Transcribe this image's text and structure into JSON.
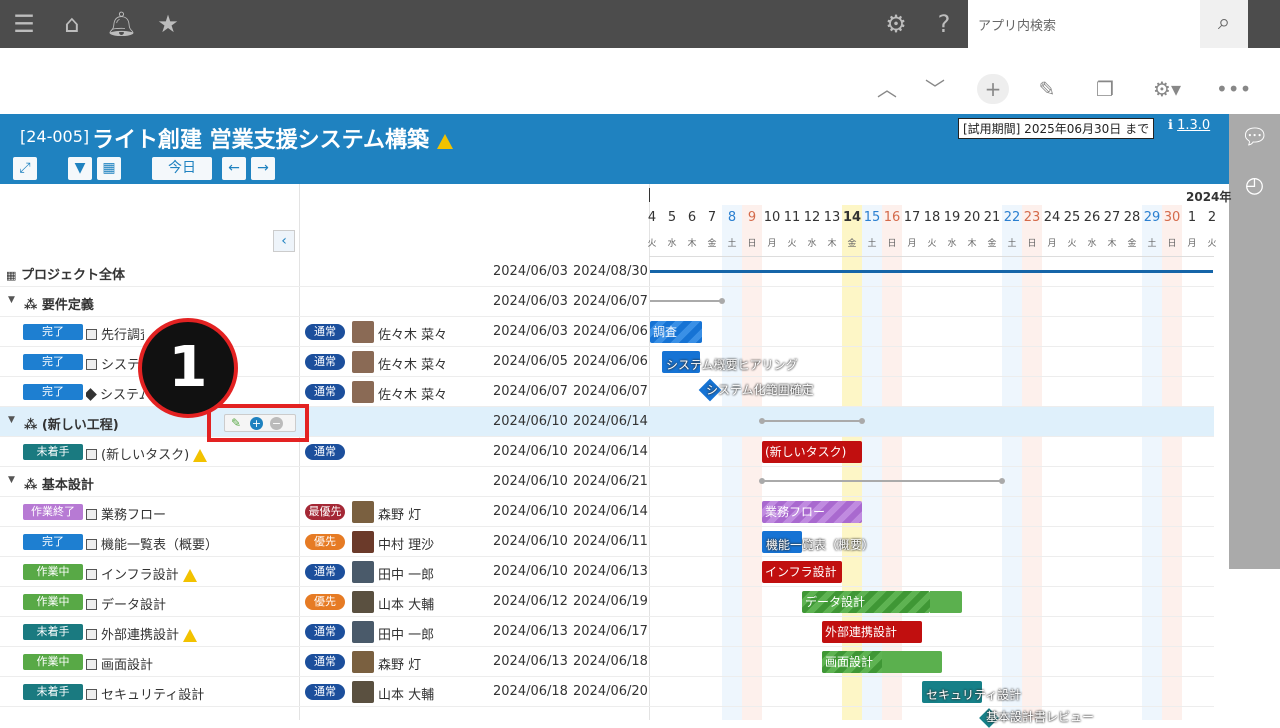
{
  "topbar": {
    "search_placeholder": "アプリ内検索"
  },
  "project": {
    "id": "[24-005]",
    "title": "ライト創建 営業支援システム構築",
    "trial": "[試用期間] 2025年06月30日 まで",
    "version": "1.3.0"
  },
  "header_buttons": {
    "today": "今日"
  },
  "calendar": {
    "year_label": "2024年",
    "days": [
      "4",
      "5",
      "6",
      "7",
      "8",
      "9",
      "10",
      "11",
      "12",
      "13",
      "14",
      "15",
      "16",
      "17",
      "18",
      "19",
      "20",
      "21",
      "22",
      "23",
      "24",
      "25",
      "26",
      "27",
      "28",
      "29",
      "30",
      "1",
      "2"
    ],
    "weekdays": [
      "火",
      "水",
      "木",
      "金",
      "土",
      "日",
      "月",
      "火",
      "水",
      "木",
      "金",
      "土",
      "日",
      "月",
      "火",
      "水",
      "木",
      "金",
      "土",
      "日",
      "月",
      "火",
      "水",
      "木",
      "金",
      "土",
      "日",
      "月",
      "火"
    ]
  },
  "rows": [
    {
      "type": "project",
      "name": "プロジェクト全体",
      "start": "2024/06/03",
      "end": "2024/08/30"
    },
    {
      "type": "phase",
      "name": "要件定義",
      "start": "2024/06/03",
      "end": "2024/06/07"
    },
    {
      "type": "task",
      "status": "完了",
      "name": "先行調査",
      "priority": "通常",
      "person": "佐々木 菜々",
      "start": "2024/06/03",
      "end": "2024/06/06"
    },
    {
      "type": "task",
      "status": "完了",
      "name": "システム概要ヒアリング",
      "priority": "通常",
      "person": "佐々木 菜々",
      "start": "2024/06/05",
      "end": "2024/06/06"
    },
    {
      "type": "milestone",
      "status": "完了",
      "name": "システム化範囲確定",
      "priority": "通常",
      "person": "佐々木 菜々",
      "start": "2024/06/07",
      "end": "2024/06/07"
    },
    {
      "type": "phase",
      "name": "(新しい工程)",
      "start": "2024/06/10",
      "end": "2024/06/14"
    },
    {
      "type": "task",
      "status": "未着手",
      "name": "(新しいタスク)",
      "priority": "通常",
      "person": "",
      "start": "2024/06/10",
      "end": "2024/06/14"
    },
    {
      "type": "phase",
      "name": "基本設計",
      "start": "2024/06/10",
      "end": "2024/06/21"
    },
    {
      "type": "task",
      "status": "作業終了",
      "name": "業務フロー",
      "priority": "最優先",
      "person": "森野 灯",
      "start": "2024/06/10",
      "end": "2024/06/14"
    },
    {
      "type": "task",
      "status": "完了",
      "name": "機能一覧表（概要）",
      "priority": "優先",
      "person": "中村 理沙",
      "start": "2024/06/10",
      "end": "2024/06/11"
    },
    {
      "type": "task",
      "status": "作業中",
      "name": "インフラ設計",
      "priority": "通常",
      "person": "田中 一郎",
      "start": "2024/06/10",
      "end": "2024/06/13"
    },
    {
      "type": "task",
      "status": "作業中",
      "name": "データ設計",
      "priority": "優先",
      "person": "山本 大輔",
      "start": "2024/06/12",
      "end": "2024/06/19"
    },
    {
      "type": "task",
      "status": "未着手",
      "name": "外部連携設計",
      "priority": "通常",
      "person": "田中 一郎",
      "start": "2024/06/13",
      "end": "2024/06/17"
    },
    {
      "type": "task",
      "status": "作業中",
      "name": "画面設計",
      "priority": "通常",
      "person": "森野 灯",
      "start": "2024/06/13",
      "end": "2024/06/18"
    },
    {
      "type": "task",
      "status": "未着手",
      "name": "セキュリティ設計",
      "priority": "通常",
      "person": "山本 大輔",
      "start": "2024/06/18",
      "end": "2024/06/20"
    }
  ],
  "bars": {
    "b0": "調査",
    "b1": "システム概要ヒアリング",
    "b2": "システム化範囲確定",
    "b3": "(新しいタスク)",
    "b4": "業務フロー",
    "b5": "機能一覧表（概要）",
    "b6": "インフラ設計",
    "b7": "データ設計",
    "b8": "外部連携設計",
    "b9": "画面設計",
    "b10": "セキュリティ設計",
    "b11": "基本設計書レビュー"
  },
  "callout": "1"
}
